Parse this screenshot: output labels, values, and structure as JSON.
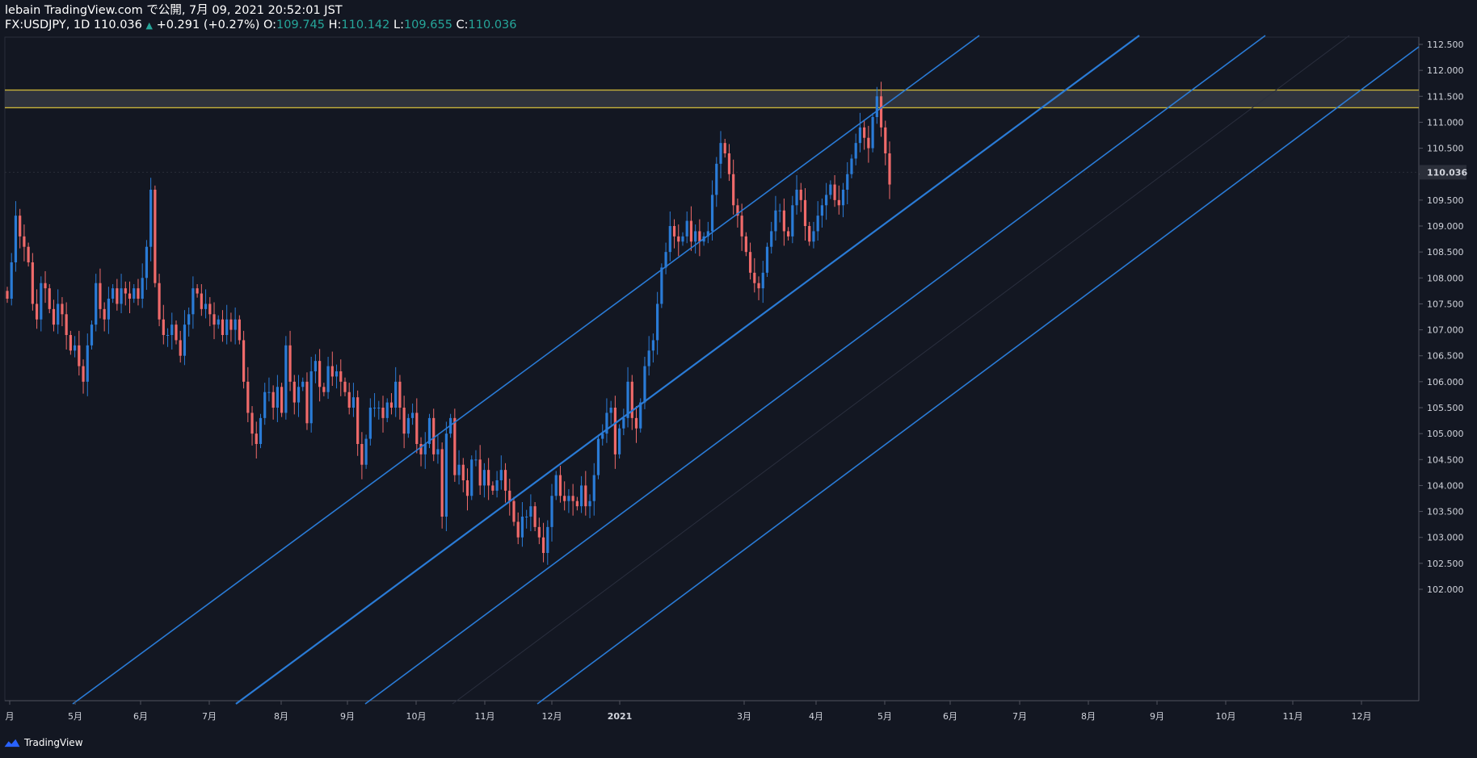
{
  "header": {
    "publish_line": "lebain TradingView.com で公開, 7月 09, 2021 20:52:01 JST",
    "symbol": "FX:USDJPY, 1D",
    "last": "110.036",
    "change_arrow": "▲",
    "change": "+0.291 (+0.27%)",
    "o_label": "O:",
    "o_value": "109.745",
    "h_label": "H:",
    "h_value": "110.142",
    "l_label": "L:",
    "l_value": "109.655",
    "c_label": "C:",
    "c_value": "110.036"
  },
  "footer": {
    "brand": "TradingView"
  },
  "price_axis": {
    "labels": [
      "112.500",
      "112.000",
      "111.500",
      "111.000",
      "110.500",
      "110.000",
      "109.500",
      "109.000",
      "108.500",
      "108.000",
      "107.500",
      "107.000",
      "106.500",
      "106.000",
      "105.500",
      "105.000",
      "104.500",
      "104.000",
      "103.500",
      "103.000",
      "102.500",
      "102.000"
    ],
    "current": "110.036"
  },
  "time_axis": {
    "labels": [
      "月",
      "5月",
      "6月",
      "7月",
      "8月",
      "9月",
      "10月",
      "11月",
      "12月",
      "2021",
      "3月",
      "4月",
      "5月",
      "6月",
      "7月",
      "8月",
      "9月",
      "10月",
      "11月",
      "12月"
    ]
  },
  "colors": {
    "background": "#131722",
    "up": "#2a7bd6",
    "down": "#ef6a6a",
    "channel": "#2a7bd6",
    "zone_line": "#c9b43a",
    "zone_fill": "#3a3d47"
  },
  "chart_data": {
    "type": "candlestick",
    "symbol": "FX:USDJPY",
    "interval": "1D",
    "ylim": [
      101.8,
      112.7
    ],
    "resistance_zone": [
      111.28,
      111.62
    ],
    "last_close": 110.036,
    "closes": [
      107.6,
      108.3,
      109.2,
      108.8,
      108.6,
      108.3,
      107.5,
      107.2,
      107.9,
      107.8,
      107.4,
      107.1,
      107.5,
      107.3,
      106.9,
      106.6,
      106.7,
      106.3,
      106.0,
      106.7,
      107.1,
      107.9,
      107.4,
      107.2,
      107.6,
      107.8,
      107.5,
      107.8,
      107.7,
      107.6,
      107.8,
      107.6,
      108.0,
      108.6,
      109.7,
      107.9,
      107.2,
      106.9,
      106.9,
      107.1,
      106.8,
      106.5,
      107.1,
      107.3,
      107.8,
      107.7,
      107.4,
      107.5,
      107.3,
      107.1,
      107.2,
      106.9,
      107.2,
      107.0,
      107.2,
      106.8,
      106.0,
      105.4,
      105.0,
      104.8,
      105.3,
      105.8,
      105.8,
      105.5,
      105.9,
      105.4,
      106.7,
      106.0,
      105.6,
      105.9,
      106.0,
      105.2,
      106.2,
      106.4,
      105.9,
      105.8,
      106.3,
      106.1,
      106.2,
      106.0,
      105.8,
      105.5,
      105.7,
      104.8,
      104.4,
      104.9,
      105.5,
      105.5,
      105.5,
      105.3,
      105.6,
      105.5,
      106.0,
      105.5,
      105.0,
      105.3,
      105.4,
      104.8,
      104.6,
      104.8,
      105.3,
      104.6,
      104.7,
      103.4,
      105.0,
      105.3,
      104.2,
      104.4,
      104.1,
      103.8,
      104.5,
      104.5,
      104.0,
      104.3,
      104.0,
      103.9,
      104.1,
      104.3,
      103.9,
      103.7,
      103.3,
      103.0,
      103.4,
      103.4,
      103.6,
      103.2,
      103.0,
      102.7,
      103.2,
      103.8,
      104.2,
      103.8,
      103.7,
      103.8,
      103.7,
      103.6,
      104.0,
      103.6,
      103.7,
      104.2,
      104.9,
      105.0,
      105.4,
      105.5,
      104.6,
      105.1,
      105.3,
      106.0,
      105.3,
      105.1,
      105.6,
      106.3,
      106.6,
      106.8,
      107.5,
      108.2,
      108.5,
      109.0,
      108.8,
      108.7,
      108.8,
      109.1,
      108.7,
      108.9,
      108.7,
      108.8,
      108.9,
      109.6,
      110.2,
      110.6,
      110.4,
      110.0,
      109.4,
      109.2,
      108.8,
      108.5,
      108.1,
      107.9,
      107.8,
      108.1,
      108.6,
      108.9,
      109.3,
      109.3,
      108.9,
      108.8,
      109.4,
      109.7,
      109.5,
      109.0,
      108.7,
      108.9,
      109.2,
      109.4,
      109.6,
      109.8,
      109.5,
      109.4,
      109.7,
      110.0,
      110.3,
      110.6,
      110.9,
      110.7,
      110.5,
      111.1,
      111.5,
      110.9,
      110.4,
      109.8
    ]
  }
}
